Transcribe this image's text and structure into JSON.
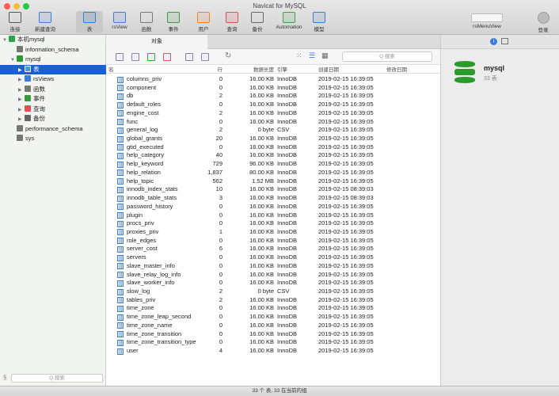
{
  "window": {
    "title": "Navicat for MySQL"
  },
  "toolbar": [
    {
      "label": "连接",
      "icon": "connection-icon",
      "color": "#555"
    },
    {
      "label": "新建查询",
      "icon": "new-query-icon",
      "color": "#3a7bd5"
    },
    {
      "label": "表",
      "icon": "table-icon",
      "color": "#3a7bd5"
    },
    {
      "label": "rsView",
      "icon": "view-icon",
      "color": "#3a7bd5"
    },
    {
      "label": "函数",
      "icon": "function-icon",
      "color": "#777"
    },
    {
      "label": "事件",
      "icon": "event-clock-icon",
      "color": "#3b9a3b"
    },
    {
      "label": "用户",
      "icon": "user-icon",
      "color": "#e8862a"
    },
    {
      "label": "查询",
      "icon": "query-icon",
      "color": "#d9534f"
    },
    {
      "label": "备份",
      "icon": "backup-icon",
      "color": "#666"
    },
    {
      "label": "Automation",
      "icon": "automation-icon",
      "color": "#4a9a4a"
    },
    {
      "label": "模型",
      "icon": "model-icon",
      "color": "#3a7bd5"
    }
  ],
  "toolbar_right": {
    "view_label": "rsMenuView",
    "login_label": "登录"
  },
  "sidebar": {
    "items": [
      {
        "label": "本机mysql",
        "level": 0,
        "arrow": "▼",
        "color": "#2da44e"
      },
      {
        "label": "information_schema",
        "level": 1,
        "arrow": "",
        "color": "#777"
      },
      {
        "label": "mysql",
        "level": 1,
        "arrow": "▼",
        "color": "#2a9a2a"
      },
      {
        "label": "表",
        "level": 2,
        "arrow": "▶",
        "color": "#fff",
        "selected": true
      },
      {
        "label": "rsViews",
        "level": 2,
        "arrow": "▶",
        "color": "#3a7bd5"
      },
      {
        "label": "函数",
        "level": 2,
        "arrow": "▶",
        "color": "#777"
      },
      {
        "label": "事件",
        "level": 2,
        "arrow": "▶",
        "color": "#3b9a3b"
      },
      {
        "label": "查询",
        "level": 2,
        "arrow": "▶",
        "color": "#d9534f"
      },
      {
        "label": "备份",
        "level": 2,
        "arrow": "▶",
        "color": "#666"
      },
      {
        "label": "performance_schema",
        "level": 1,
        "arrow": "",
        "color": "#777"
      },
      {
        "label": "sys",
        "level": 1,
        "arrow": "",
        "color": "#777"
      }
    ],
    "search_placeholder": "Q 搜索"
  },
  "main": {
    "tab": "对象",
    "search_placeholder": "Q 搜索",
    "columns": [
      "名",
      "行",
      "数据长度",
      "引擎",
      "创建日期",
      "修改日期"
    ],
    "rows": [
      [
        "columns_priv",
        "0",
        "16.00 KB",
        "InnoDB",
        "2019-02-15 16:39:05"
      ],
      [
        "component",
        "0",
        "16.00 KB",
        "InnoDB",
        "2019-02-15 16:39:05"
      ],
      [
        "db",
        "2",
        "16.00 KB",
        "InnoDB",
        "2019-02-15 16:39:05"
      ],
      [
        "default_roles",
        "0",
        "16.00 KB",
        "InnoDB",
        "2019-02-15 16:39:05"
      ],
      [
        "engine_cost",
        "2",
        "16.00 KB",
        "InnoDB",
        "2019-02-15 16:39:05"
      ],
      [
        "func",
        "0",
        "16.00 KB",
        "InnoDB",
        "2019-02-15 16:39:05"
      ],
      [
        "general_log",
        "2",
        "0 byte",
        "CSV",
        "2019-02-15 16:39:05"
      ],
      [
        "global_grants",
        "20",
        "16.00 KB",
        "InnoDB",
        "2019-02-15 16:39:05"
      ],
      [
        "gtid_executed",
        "0",
        "16.00 KB",
        "InnoDB",
        "2019-02-15 16:39:05"
      ],
      [
        "help_category",
        "40",
        "16.00 KB",
        "InnoDB",
        "2019-02-15 16:39:05"
      ],
      [
        "help_keyword",
        "729",
        "96.00 KB",
        "InnoDB",
        "2019-02-15 16:39:05"
      ],
      [
        "help_relation",
        "1,837",
        "80.00 KB",
        "InnoDB",
        "2019-02-15 16:39:05"
      ],
      [
        "help_topic",
        "562",
        "1.52 MB",
        "InnoDB",
        "2019-02-15 16:39:05"
      ],
      [
        "innodb_index_stats",
        "10",
        "16.00 KB",
        "InnoDB",
        "2019-02-15 08:39:03"
      ],
      [
        "innodb_table_stats",
        "3",
        "16.00 KB",
        "InnoDB",
        "2019-02-15 08:39:03"
      ],
      [
        "password_history",
        "0",
        "16.00 KB",
        "InnoDB",
        "2019-02-15 16:39:05"
      ],
      [
        "plugin",
        "0",
        "16.00 KB",
        "InnoDB",
        "2019-02-15 16:39:05"
      ],
      [
        "procs_priv",
        "0",
        "16.00 KB",
        "InnoDB",
        "2019-02-15 16:39:05"
      ],
      [
        "proxies_priv",
        "1",
        "16.00 KB",
        "InnoDB",
        "2019-02-15 16:39:05"
      ],
      [
        "role_edges",
        "0",
        "16.00 KB",
        "InnoDB",
        "2019-02-15 16:39:05"
      ],
      [
        "server_cost",
        "6",
        "16.00 KB",
        "InnoDB",
        "2019-02-15 16:39:05"
      ],
      [
        "servers",
        "0",
        "16.00 KB",
        "InnoDB",
        "2019-02-15 16:39:05"
      ],
      [
        "slave_master_info",
        "0",
        "16.00 KB",
        "InnoDB",
        "2019-02-15 16:39:05"
      ],
      [
        "slave_relay_log_info",
        "0",
        "16.00 KB",
        "InnoDB",
        "2019-02-15 16:39:05"
      ],
      [
        "slave_worker_info",
        "0",
        "16.00 KB",
        "InnoDB",
        "2019-02-15 16:39:05"
      ],
      [
        "slow_log",
        "2",
        "0 byte",
        "CSV",
        "2019-02-15 16:39:05"
      ],
      [
        "tables_priv",
        "2",
        "16.00 KB",
        "InnoDB",
        "2019-02-15 16:39:05"
      ],
      [
        "time_zone",
        "0",
        "16.00 KB",
        "InnoDB",
        "2019-02-15 16:39:05"
      ],
      [
        "time_zone_leap_second",
        "0",
        "16.00 KB",
        "InnoDB",
        "2019-02-15 16:39:05"
      ],
      [
        "time_zone_name",
        "0",
        "16.00 KB",
        "InnoDB",
        "2019-02-15 16:39:05"
      ],
      [
        "time_zone_transition",
        "0",
        "16.00 KB",
        "InnoDB",
        "2019-02-15 16:39:05"
      ],
      [
        "time_zone_transition_type",
        "0",
        "16.00 KB",
        "InnoDB",
        "2019-02-15 16:39:05"
      ],
      [
        "user",
        "4",
        "16.00 KB",
        "InnoDB",
        "2019-02-15 16:39:05"
      ]
    ]
  },
  "info_panel": {
    "name": "mysql",
    "count": "33 表",
    "accent": "#2a9a2a"
  },
  "status": "33 个 表, 33 在当前的组"
}
